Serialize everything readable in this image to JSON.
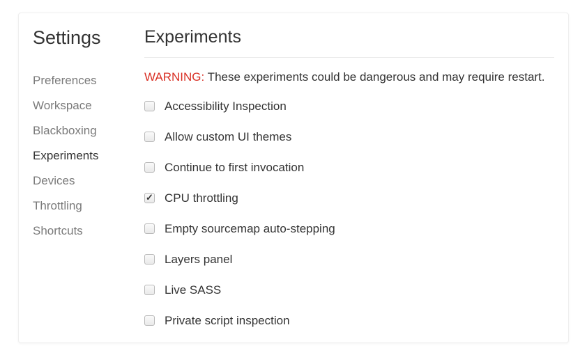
{
  "sidebar": {
    "title": "Settings",
    "items": [
      {
        "label": "Preferences"
      },
      {
        "label": "Workspace"
      },
      {
        "label": "Blackboxing"
      },
      {
        "label": "Experiments"
      },
      {
        "label": "Devices"
      },
      {
        "label": "Throttling"
      },
      {
        "label": "Shortcuts"
      }
    ]
  },
  "main": {
    "title": "Experiments",
    "warning_label": "WARNING:",
    "warning_text": " These experiments could be dangerous and may require restart.",
    "experiments": [
      {
        "label": "Accessibility Inspection",
        "checked": false
      },
      {
        "label": "Allow custom UI themes",
        "checked": false
      },
      {
        "label": "Continue to first invocation",
        "checked": false
      },
      {
        "label": "CPU throttling",
        "checked": true
      },
      {
        "label": "Empty sourcemap auto-stepping",
        "checked": false
      },
      {
        "label": "Layers panel",
        "checked": false
      },
      {
        "label": "Live SASS",
        "checked": false
      },
      {
        "label": "Private script inspection",
        "checked": false
      }
    ]
  }
}
